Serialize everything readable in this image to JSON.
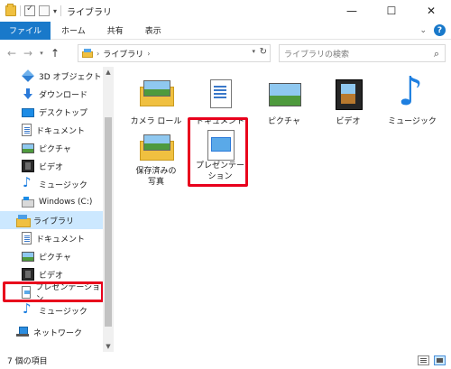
{
  "window": {
    "title": "ライブラリ",
    "controls": {
      "minimize": "—",
      "maximize": "☐",
      "close": "✕"
    }
  },
  "ribbon": {
    "tabs": [
      "ファイル",
      "ホーム",
      "共有",
      "表示"
    ]
  },
  "address": {
    "path": "ライブラリ",
    "separator": "›",
    "search_placeholder": "ライブラリの検索"
  },
  "sidebar": {
    "items": [
      {
        "label": "3D オブジェクト",
        "icon": "cube-3d-icon"
      },
      {
        "label": "ダウンロード",
        "icon": "download-arrow-icon"
      },
      {
        "label": "デスクトップ",
        "icon": "desktop-icon"
      },
      {
        "label": "ドキュメント",
        "icon": "document-icon"
      },
      {
        "label": "ピクチャ",
        "icon": "picture-icon"
      },
      {
        "label": "ビデオ",
        "icon": "video-icon"
      },
      {
        "label": "ミュージック",
        "icon": "music-note-icon"
      },
      {
        "label": "Windows (C:)",
        "icon": "drive-icon"
      },
      {
        "label": "ライブラリ",
        "icon": "library-icon"
      },
      {
        "label": "ドキュメント",
        "icon": "document-icon"
      },
      {
        "label": "ピクチャ",
        "icon": "picture-icon"
      },
      {
        "label": "ビデオ",
        "icon": "video-icon"
      },
      {
        "label": "プレゼンテーション",
        "icon": "presentation-icon"
      },
      {
        "label": "ミュージック",
        "icon": "music-note-icon"
      },
      {
        "label": "ネットワーク",
        "icon": "network-icon"
      }
    ],
    "selected_label": "ライブラリ"
  },
  "content": {
    "tiles": [
      {
        "label": "カメラ ロール",
        "icon": "camera-roll-icon"
      },
      {
        "label": "ドキュメント",
        "icon": "documents-library-icon"
      },
      {
        "label": "ピクチャ",
        "icon": "pictures-library-icon"
      },
      {
        "label": "ビデオ",
        "icon": "videos-library-icon"
      },
      {
        "label": "ミュージック",
        "icon": "music-library-icon"
      },
      {
        "label": "保存済みの写真",
        "label_line1": "保存済みの",
        "label_line2": "写真",
        "icon": "saved-pictures-icon"
      },
      {
        "label": "プレゼンテーション",
        "label_line1": "プレゼンテー",
        "label_line2": "ション",
        "icon": "presentation-library-icon"
      }
    ]
  },
  "status": {
    "item_count": "7 個の項目"
  },
  "colors": {
    "accent": "#1979ca",
    "highlight_box": "#e8001c",
    "selection": "#cce8ff",
    "folder": "#f0c040"
  }
}
